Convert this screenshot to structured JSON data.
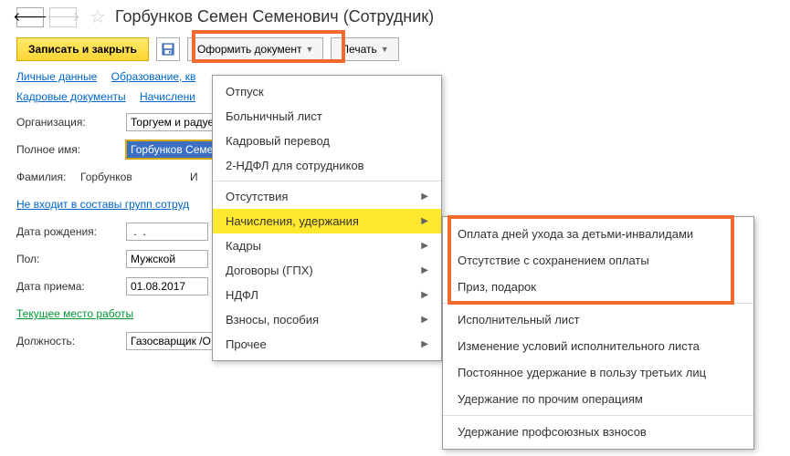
{
  "header": {
    "title": "Горбунков Семен Семенович (Сотрудник)"
  },
  "toolbar": {
    "save_close": "Записать и закрыть",
    "create_doc": "Оформить документ",
    "print": "Печать"
  },
  "links1": {
    "personal": "Личные данные",
    "education": "Образование, кв"
  },
  "links2": {
    "hr_docs": "Кадровые документы",
    "accruals": "Начислени"
  },
  "form": {
    "org_label": "Организация:",
    "org_value": "Торгуем и радуе",
    "fullname_label": "Полное имя:",
    "fullname_value": "Горбунков Семен",
    "surname_label": "Фамилия:",
    "surname_value": "Горбунков",
    "name_label": "И",
    "groups_link": "Не входит в составы групп сотруд",
    "dob_label": "Дата рождения:",
    "dob_value": " .  .    ",
    "sex_label": "Пол:",
    "sex_value": "Мужской",
    "hire_label": "Дата приема:",
    "hire_value": "01.08.2017",
    "current_place": "Текущее место работы",
    "position_label": "Должность:",
    "position_value": "Газосварщик /О"
  },
  "menu": {
    "items": [
      "Отпуск",
      "Больничный лист",
      "Кадровый перевод",
      "2-НДФЛ для сотрудников"
    ],
    "sub_items": [
      "Отсутствия",
      "Начисления, удержания",
      "Кадры",
      "Договоры (ГПХ)",
      "НДФЛ",
      "Взносы, пособия",
      "Прочее"
    ]
  },
  "submenu": {
    "top": [
      "Оплата дней ухода за детьми-инвалидами",
      "Отсутствие с сохранением оплаты",
      "Приз, подарок"
    ],
    "bottom": [
      "Исполнительный лист",
      "Изменение условий исполнительного листа",
      "Постоянное удержание в пользу третьих лиц",
      "Удержание по прочим операциям"
    ],
    "last": "Удержание профсоюзных взносов"
  }
}
